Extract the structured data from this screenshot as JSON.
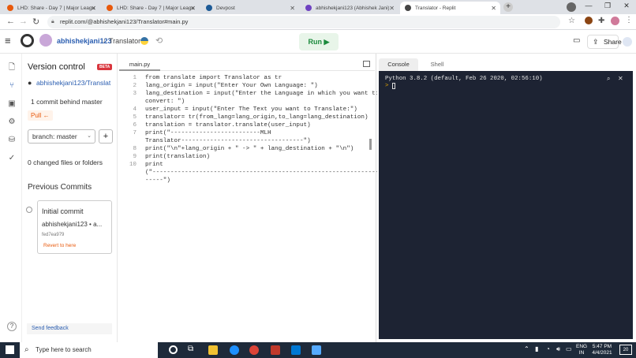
{
  "browser": {
    "tabs": [
      {
        "label": "LHD: Share - Day 7 | Major Leagu",
        "color": "#e8590c",
        "active": false
      },
      {
        "label": "LHD: Share - Day 7 | Major Leagu",
        "color": "#e8590c",
        "active": false
      },
      {
        "label": "Devpost",
        "color": "#1d5a96",
        "active": false
      },
      {
        "label": "abhishekjani123 (Abhishek Jani)",
        "color": "#6f42c1",
        "active": false
      },
      {
        "label": "Translator - Replit",
        "color": "#444444",
        "active": true
      }
    ],
    "url": "replit.com/@abhishekjani123/Translator#main.py"
  },
  "header": {
    "user": "abhishekjani123",
    "separator": "/",
    "project": "Translator",
    "run_label": "Run",
    "share_label": "Share"
  },
  "vc": {
    "title": "Version control",
    "beta": "BETA",
    "repo": "abhishekjani123/Translat",
    "commits_behind": "1 commit behind master",
    "pull": "Pull ←",
    "branch": "branch: master",
    "add": "+",
    "changed": "0 changed files or folders",
    "previous_commits": "Previous Commits",
    "commit": {
      "title": "Initial commit",
      "author": "abhishekjani123 • a...",
      "hash": "fed7ea979",
      "revert": "Revert to here"
    },
    "feedback": "Send feedback",
    "help": "?"
  },
  "editor": {
    "filename": "main.py",
    "line_numbers": [
      "1",
      "2",
      "3",
      "",
      "4",
      "5",
      "6",
      "7",
      "",
      "8",
      "9",
      "10",
      "",
      ""
    ],
    "lines": [
      "from translate import Translator as tr",
      "lang_origin = input(\"Enter Your Own Language: \")",
      "lang_destination = input(\"Enter the Language in which you want to",
      "convert: \")",
      "user_input = input(\"Enter The Text you want to Translate:\")",
      "translator= tr(from_lang=lang_origin,to_lang=lang_destination)",
      "translation = translator.translate(user_input)",
      "print(\"-------------------------MLH",
      "Translator----------------------------------\")",
      "print(\"\\n\"+lang_origin + \" -> \" + lang_destination + \"\\n\")",
      "print(translation)",
      "print",
      "(\"-----------------------------------------------------------------",
      "-----\")"
    ]
  },
  "console": {
    "tab_console": "Console",
    "tab_shell": "Shell",
    "output_line1": "Python 3.8.2 (default, Feb 26 2020, 02:56:10)",
    "prompt": "> "
  },
  "taskbar": {
    "search_placeholder": "Type here to search",
    "lang": "ENG",
    "region": "IN",
    "time": "5:47 PM",
    "date": "4/4/2021",
    "notif_count": "20"
  }
}
